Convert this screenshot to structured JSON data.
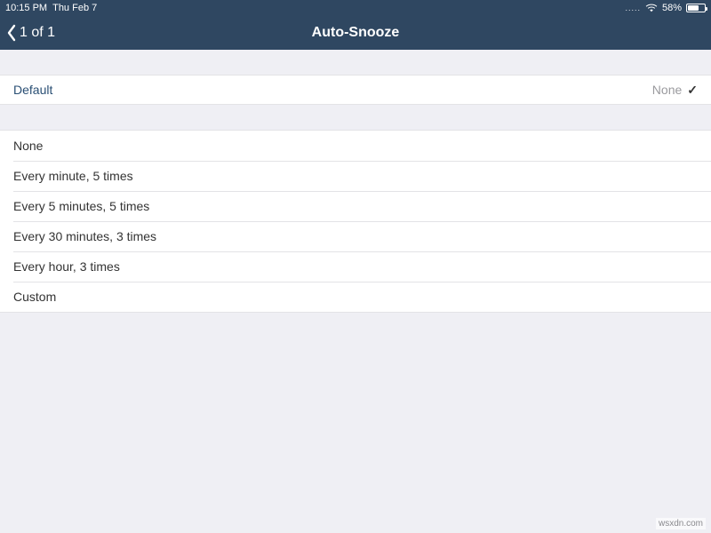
{
  "status": {
    "time": "10:15 PM",
    "date": "Thu Feb 7",
    "battery_percent": "58%",
    "signal_dots": "....."
  },
  "nav": {
    "back_label": "1 of 1",
    "title": "Auto-Snooze"
  },
  "default_row": {
    "label": "Default",
    "value": "None"
  },
  "options": [
    {
      "label": "None"
    },
    {
      "label": "Every minute, 5 times"
    },
    {
      "label": "Every 5 minutes, 5 times"
    },
    {
      "label": "Every 30 minutes, 3 times"
    },
    {
      "label": "Every hour, 3 times"
    },
    {
      "label": "Custom"
    }
  ],
  "watermark": "wsxdn.com"
}
